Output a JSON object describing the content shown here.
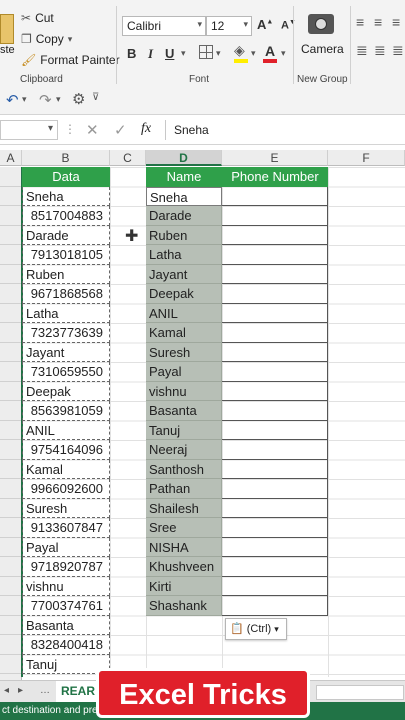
{
  "ribbon": {
    "clipboard": {
      "cut": "Cut",
      "copy": "Copy",
      "format_painter": "Format Painter",
      "paste_fragment": "ste",
      "group_label": "Clipboard"
    },
    "font": {
      "name": "Calibri",
      "size": "12",
      "group_label": "Font"
    },
    "new_group": {
      "camera": "Camera",
      "group_label": "New Group"
    }
  },
  "formula_bar": {
    "fx": "fx",
    "value": "Sneha"
  },
  "columns": [
    "A",
    "B",
    "C",
    "D",
    "E",
    "F"
  ],
  "sheet": {
    "headers": {
      "data": "Data",
      "name": "Name",
      "phone": "Phone Number"
    },
    "data_col": [
      "Sneha",
      "8517004883",
      "Darade",
      "7913018105",
      "Ruben",
      "9671868568",
      "Latha",
      "7323773639",
      "Jayant",
      "7310659550",
      "Deepak",
      "8563981059",
      "ANIL",
      "9754164096",
      "Kamal",
      "9966092600",
      "Suresh",
      "9133607847",
      "Payal",
      "9718920787",
      "vishnu",
      "7700374761",
      "Basanta",
      "8328400418",
      "Tanuj"
    ],
    "name_col": [
      "Sneha",
      "Darade",
      "Ruben",
      "Latha",
      "Jayant",
      "Deepak",
      "ANIL",
      "Kamal",
      "Suresh",
      "Payal",
      "vishnu",
      "Basanta",
      "Tanuj",
      "Neeraj",
      "Santhosh",
      "Pathan",
      "Shailesh",
      "Sree",
      "NISHA",
      "Khushveen",
      "Kirti",
      "Shashank"
    ]
  },
  "paste_options": "(Ctrl)",
  "sheet_tab": "REAR",
  "status_text": "ct destination and pre",
  "banner": "Excel Tricks"
}
